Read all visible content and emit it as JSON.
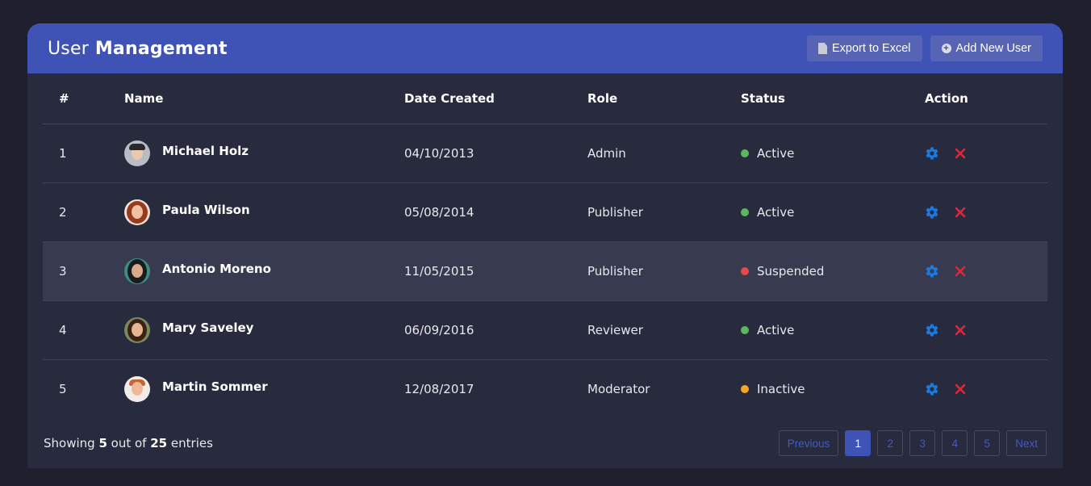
{
  "header": {
    "title_light": "User",
    "title_bold": "Management",
    "export_label": "Export to Excel",
    "export_icon": "file-icon",
    "add_label": "Add New User",
    "add_icon": "plus-circle-icon"
  },
  "table": {
    "columns": [
      "#",
      "Name",
      "Date Created",
      "Role",
      "Status",
      "Action"
    ],
    "rows": [
      {
        "num": "1",
        "name": "Michael Holz",
        "date": "04/10/2013",
        "role": "Admin",
        "status": "Active",
        "status_color": "#5cb85c"
      },
      {
        "num": "2",
        "name": "Paula Wilson",
        "date": "05/08/2014",
        "role": "Publisher",
        "status": "Active",
        "status_color": "#5cb85c"
      },
      {
        "num": "3",
        "name": "Antonio Moreno",
        "date": "11/05/2015",
        "role": "Publisher",
        "status": "Suspended",
        "status_color": "#e34b4b"
      },
      {
        "num": "4",
        "name": "Mary Saveley",
        "date": "06/09/2016",
        "role": "Reviewer",
        "status": "Active",
        "status_color": "#5cb85c"
      },
      {
        "num": "5",
        "name": "Martin Sommer",
        "date": "12/08/2017",
        "role": "Moderator",
        "status": "Inactive",
        "status_color": "#f5a623"
      }
    ],
    "action_icons": [
      "gear-icon",
      "close-icon"
    ]
  },
  "footer": {
    "showing_prefix": "Showing",
    "shown": "5",
    "middle": "out of",
    "total": "25",
    "suffix": "entries"
  },
  "pagination": {
    "previous": "Previous",
    "pages": [
      "1",
      "2",
      "3",
      "4",
      "5"
    ],
    "current": "1",
    "next": "Next"
  },
  "colors": {
    "accent": "#3f53b6",
    "background": "#1f1f2e",
    "card": "#282a3d",
    "settings_icon": "#1a7ae0",
    "delete_icon": "#e0263a"
  }
}
